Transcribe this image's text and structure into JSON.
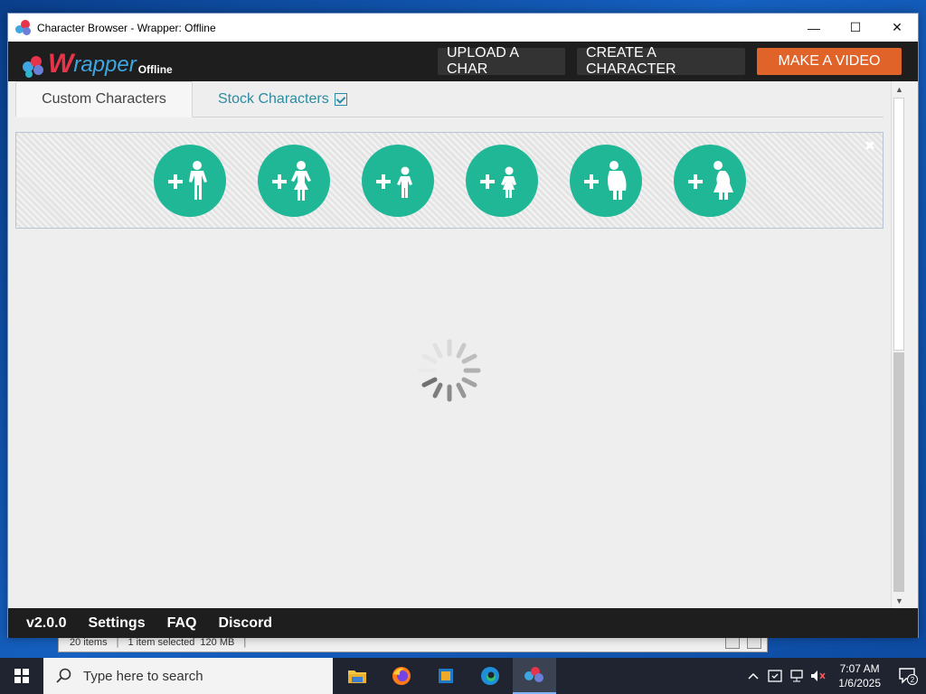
{
  "window": {
    "title": "Character Browser - Wrapper: Offline",
    "controls": {
      "minimize": "—",
      "maximize": "☐",
      "close": "✕"
    }
  },
  "header": {
    "logo_w": "W",
    "logo_rest": "rapper",
    "logo_sub": "Offline",
    "buttons": {
      "upload": "UPLOAD A CHAR",
      "create": "CREATE A CHARACTER",
      "make": "MAKE A VIDEO"
    }
  },
  "tabs": {
    "custom": "Custom Characters",
    "stock": "Stock Characters"
  },
  "add_panel": {
    "close_glyph": "✖",
    "buttons": [
      {
        "icon": "add-man-icon"
      },
      {
        "icon": "add-woman-icon"
      },
      {
        "icon": "add-boy-icon"
      },
      {
        "icon": "add-girl-icon"
      },
      {
        "icon": "add-large-man-icon"
      },
      {
        "icon": "add-large-woman-icon"
      }
    ]
  },
  "footer": {
    "version": "v2.0.0",
    "settings": "Settings",
    "faq": "FAQ",
    "discord": "Discord"
  },
  "explorer_status": {
    "items": "20 items",
    "selected": "1 item selected",
    "size": "120 MB"
  },
  "taskbar": {
    "search_placeholder": "Type here to search",
    "time": "7:07 AM",
    "date": "1/6/2025",
    "notifications": "2"
  },
  "colors": {
    "accent_teal": "#20b797",
    "make_video_orange": "#e0642a",
    "stock_tab_blue": "#2b8ca3"
  }
}
